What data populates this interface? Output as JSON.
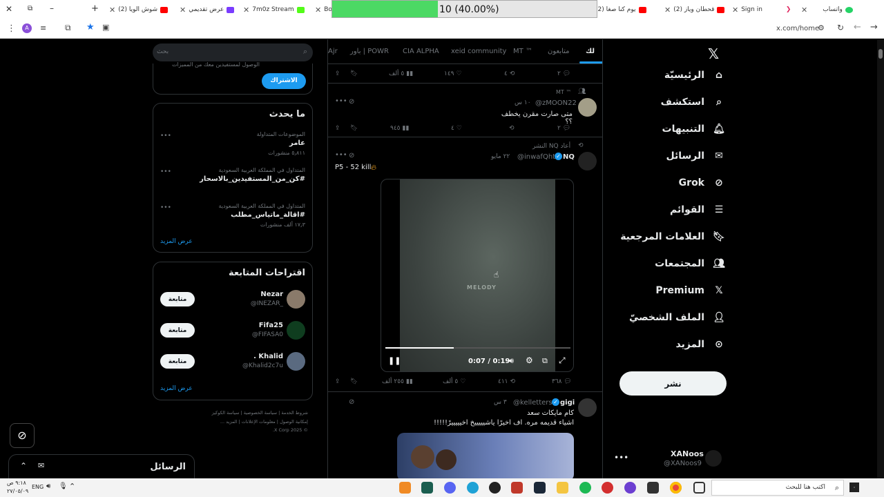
{
  "browser": {
    "tabs": [
      {
        "label": "واتساب",
        "color": "#25d366"
      },
      {
        "label": "Sign in",
        "color": "#e0245e"
      },
      {
        "label": "(2) قحطان وياز",
        "color": "#ff0000"
      },
      {
        "label": "(2) يوم كنا صغا",
        "color": "#ff0000"
      },
      {
        "label": "Bo",
        "color": "#555555"
      },
      {
        "label": "7m0z Stream",
        "color": "#53fc18"
      },
      {
        "label": "عرض تقديمي",
        "color": "#7a3cff"
      },
      {
        "label": "(2) شوش الويا",
        "color": "#ff0000"
      }
    ],
    "progress_text": "10 (40.00%)",
    "progress_fraction": 0.4,
    "url": "x.com/home"
  },
  "nav": {
    "items": [
      {
        "label": "الرئيسيّة",
        "icon": "home-icon"
      },
      {
        "label": "استكشف",
        "icon": "search-icon"
      },
      {
        "label": "التنبيهات",
        "icon": "bell-icon"
      },
      {
        "label": "الرسائل",
        "icon": "mail-icon"
      },
      {
        "label": "Grok",
        "icon": "grok-icon"
      },
      {
        "label": "القوائم",
        "icon": "list-icon"
      },
      {
        "label": "العلامات المرجعية",
        "icon": "bookmark-icon"
      },
      {
        "label": "المجتمعات",
        "icon": "communities-icon"
      },
      {
        "label": "Premium",
        "icon": "x-logo-icon"
      },
      {
        "label": "الملف الشخصيّ",
        "icon": "profile-icon"
      },
      {
        "label": "المزيد",
        "icon": "more-icon"
      }
    ],
    "post_button": "نشر",
    "account": {
      "name": "XANoos",
      "handle": "@XANoos9"
    }
  },
  "feed": {
    "tabs": [
      "لك",
      "متابعون",
      "MT ™",
      "xeid community",
      "CIA ALPHA",
      "باور | POWR",
      "Ajr"
    ],
    "top_actions": {
      "replies": "٢",
      "reposts": "٤",
      "likes": "١٤٩",
      "views": "٥ ألف"
    },
    "tweet1": {
      "community": "MT ™",
      "handle": "@zMOON22",
      "time": "١٠ س",
      "text": "متى صارت مقرن يخطف ؟؟",
      "replies": "٢",
      "likes": "٤",
      "views": "٩٤٥"
    },
    "tweet2": {
      "repost_by": "أعاد NQ النشر",
      "name": "NQ",
      "handle": "@inwafQht",
      "time": "٢٢ مايو",
      "text": "P5 - 52 kill",
      "video_watermark": "MELODY",
      "video_time": "0:07 / 0:19",
      "video_progress": 0.368,
      "replies": "٣٦٨",
      "reposts": "٤١١",
      "likes": "٥ ألف",
      "views": "٢٥٥ ألف"
    },
    "tweet3": {
      "name": "gigi",
      "handle": "@kelletters",
      "time": "٣ س",
      "line1": "كام مايكات سعد",
      "line2": "اشياء قديمه مره. اف اخيرًا ياشيييييخ اخيييييرً!!!!!"
    }
  },
  "sidebar": {
    "search_placeholder": "بحث",
    "subscribe_button": "الاشتراك",
    "subscribe_text": "الوصول لمستفيدين معك من المميزات",
    "trends_title": "ما يحدث",
    "trends": [
      {
        "context": "الموضوعات المتداولة",
        "name": "عامر",
        "count": "٥٫٨١١ منشورات"
      },
      {
        "context": "المتداول في المملكة العربية السعودية",
        "name": "#كن_من_المستفيدين_بالاسحار",
        "count": ""
      },
      {
        "context": "المتداول في المملكة العربية السعودية",
        "name": "#اقالة_ماتياس_مطلب",
        "count": "١٧٫٣ ألف منشورات"
      }
    ],
    "show_more": "عرض المزيد",
    "follow_title": "اقتراحات المتابعة",
    "suggestions": [
      {
        "name": "Nezar",
        "handle": "@INEZAR_",
        "button": "متابعة"
      },
      {
        "name": "Fifa25",
        "handle": "@FIFASA0",
        "button": "متابعة"
      },
      {
        "name": "Khalid .",
        "handle": "@Khalid2c7u",
        "button": "متابعة"
      }
    ],
    "footer_row1": [
      "شروط الخدمة",
      "سياسة الخصوصية",
      "سياسة الكوكيز"
    ],
    "footer_row2": [
      "إمكانية الوصول",
      "معلومات الإعلانات",
      "المزيد ..."
    ],
    "copyright": "© 2025 X Corp."
  },
  "messages_bar": {
    "label": "الرسائل"
  },
  "taskbar": {
    "search_placeholder": "اكتب هنا للبحث",
    "lang": "ENG",
    "time": "٩:١٨ ص",
    "date": "٢٧/٠٥/٠٩"
  }
}
